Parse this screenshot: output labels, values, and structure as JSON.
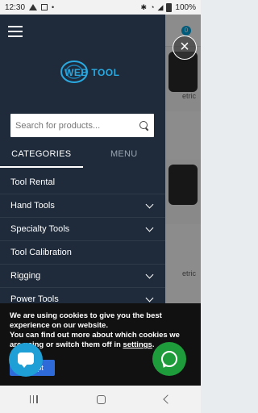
{
  "status": {
    "time": "12:30",
    "battery": "100%"
  },
  "header": {
    "cart_count": "0"
  },
  "logo": {
    "text": "WEB TOOL"
  },
  "search": {
    "placeholder": "Search for products..."
  },
  "tabs": [
    {
      "label": "CATEGORIES"
    },
    {
      "label": "MENU"
    }
  ],
  "menu": {
    "items": [
      {
        "label": "Tool Rental"
      },
      {
        "label": "Hand Tools"
      },
      {
        "label": "Specialty Tools"
      },
      {
        "label": "Tool Calibration"
      },
      {
        "label": "Rigging"
      },
      {
        "label": "Power Tools"
      }
    ]
  },
  "background": {
    "product_text_1": "etric",
    "product_text_2": "etric"
  },
  "cookie": {
    "line1": "We are using cookies to give you the best experience on our website.",
    "line2_start": "You can find out more about which cookies we are using or switch them off in ",
    "settings_link": "settings",
    "line2_end": ".",
    "accept_label": "Accept"
  }
}
